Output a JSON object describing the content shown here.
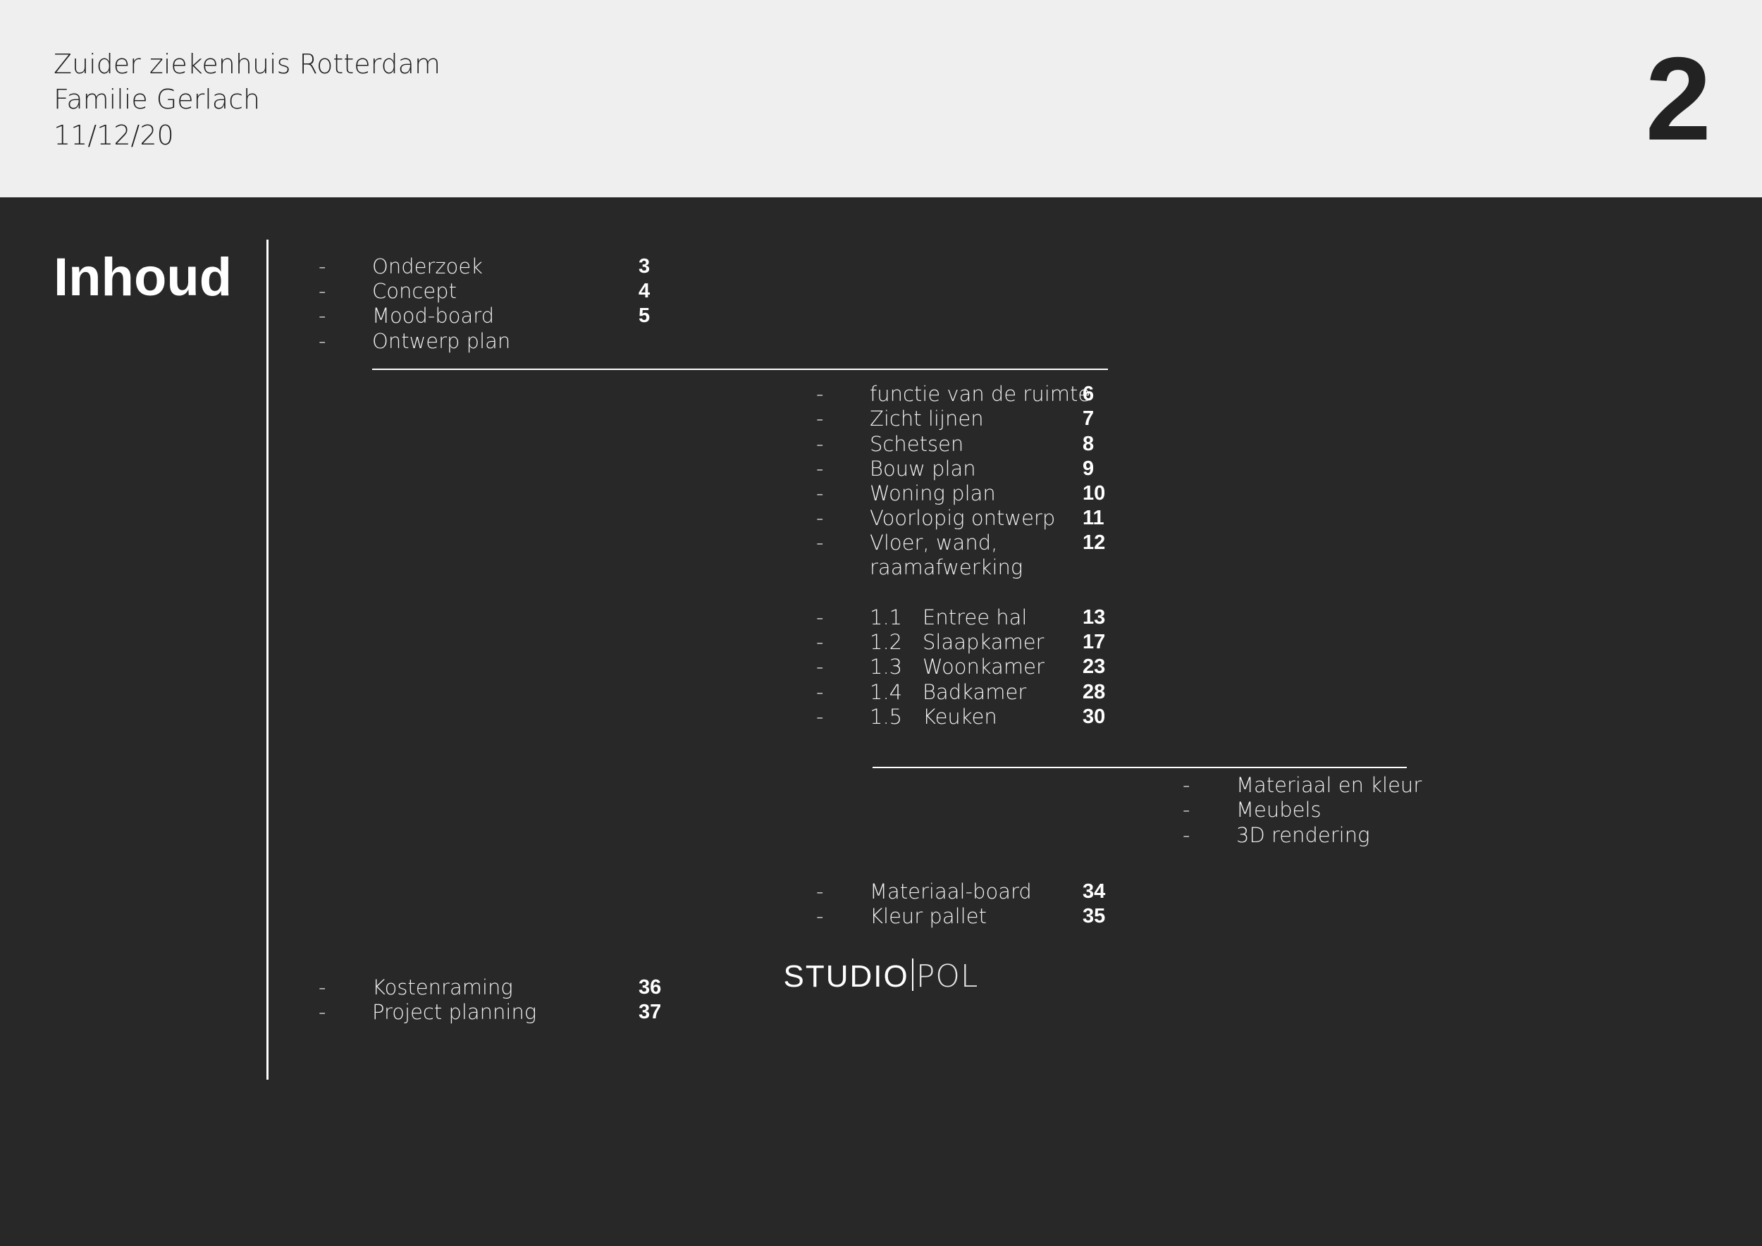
{
  "header": {
    "line1": "Zuider ziekenhuis Rotterdam",
    "line2": "Familie Gerlach",
    "line3": "11/12/20",
    "page_number": "2"
  },
  "title": "Inhoud",
  "bullet": "-",
  "toc_level1_top": [
    {
      "label": "Onderzoek",
      "page": "3"
    },
    {
      "label": "Concept",
      "page": "4"
    },
    {
      "label": "Mood-board",
      "page": "5"
    },
    {
      "label": "Ontwerp plan",
      "page": ""
    }
  ],
  "toc_level2": [
    {
      "label": "functie van de ruimte",
      "page": "6"
    },
    {
      "label": "Zicht lijnen",
      "page": "7"
    },
    {
      "label": "Schetsen",
      "page": "8"
    },
    {
      "label": "Bouw plan",
      "page": "9"
    },
    {
      "label": "Woning plan",
      "page": "10"
    },
    {
      "label": "Voorlopig ontwerp",
      "page": "11"
    },
    {
      "label": "Vloer, wand,",
      "page": "12"
    },
    {
      "label": "raamafwerking",
      "page": ""
    }
  ],
  "toc_rooms": [
    {
      "num": "1.1",
      "label": "Entree hal",
      "page": "13"
    },
    {
      "num": "1.2",
      "label": "Slaapkamer",
      "page": "17"
    },
    {
      "num": "1.3",
      "label": "Woonkamer",
      "page": "23"
    },
    {
      "num": "1.4",
      "label": "Badkamer",
      "page": "28"
    },
    {
      "num": "1.5",
      "label": "Keuken",
      "page": "30"
    }
  ],
  "toc_level3": [
    {
      "label": "Materiaal en kleur"
    },
    {
      "label": "Meubels"
    },
    {
      "label": "3D rendering"
    }
  ],
  "toc_level2_bottom": [
    {
      "label": "Materiaal-board",
      "page": "34"
    },
    {
      "label": "Kleur pallet",
      "page": "35"
    }
  ],
  "toc_level1_bottom": [
    {
      "label": "Kostenraming",
      "page": "36"
    },
    {
      "label": "Project planning",
      "page": "37"
    }
  ],
  "footer": {
    "brand_left": "STUDIO",
    "brand_right": "POL"
  }
}
